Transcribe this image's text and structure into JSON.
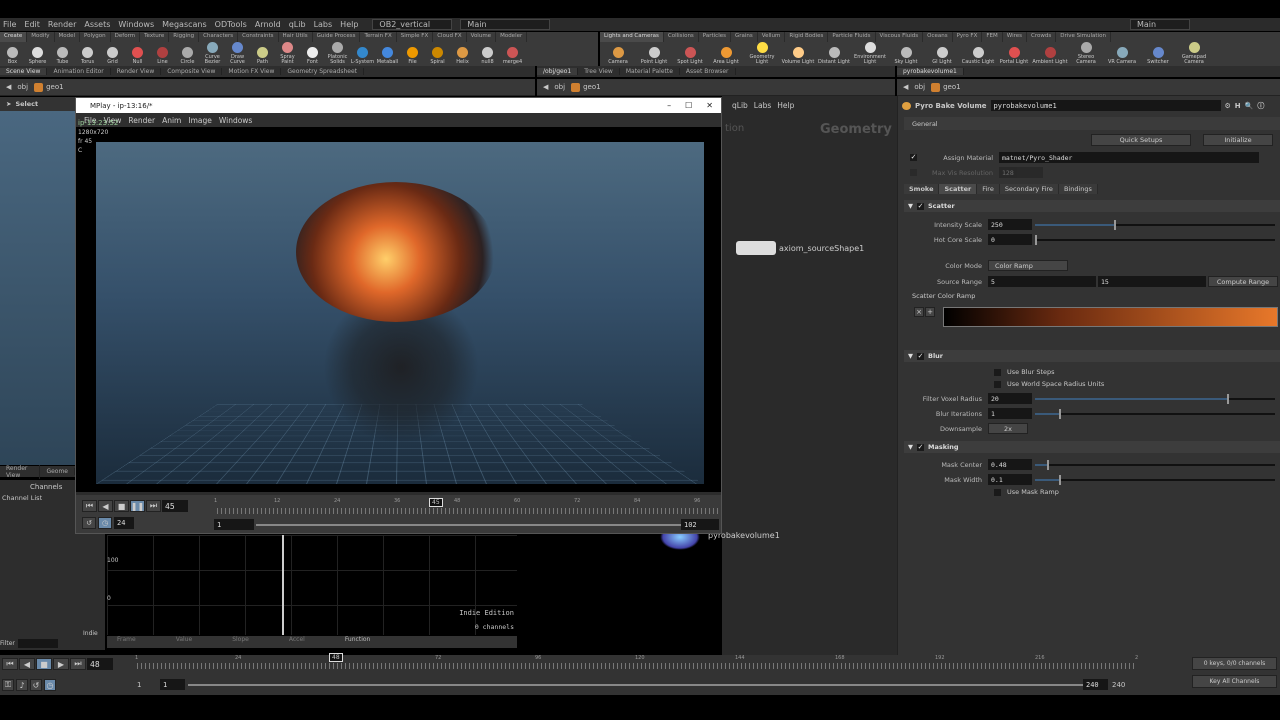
{
  "menu": [
    "File",
    "Edit",
    "Render",
    "Assets",
    "Windows",
    "Megascans",
    "ODTools",
    "Arnold",
    "qLib",
    "Labs",
    "Help"
  ],
  "desktop": "OB2_vertical",
  "context": "Main",
  "context_right": "Main",
  "shelf_tabs_left": [
    "Create",
    "Modify",
    "Model",
    "Polygon",
    "Deform",
    "Texture",
    "Rigging",
    "Characters",
    "Constraints",
    "Hair Utils",
    "Guide Process",
    "Terrain FX",
    "Simple FX",
    "Cloud FX",
    "Volume",
    "Modeler"
  ],
  "shelf_tools_left": [
    "Box",
    "Sphere",
    "Tube",
    "Torus",
    "Grid",
    "Null",
    "Line",
    "Circle",
    "Curve Bezier",
    "Draw Curve",
    "Path",
    "Spray Paint",
    "Font",
    "Platonic Solids",
    "L-System",
    "Metaball",
    "File",
    "Spiral",
    "Helix",
    "null8",
    "merge4"
  ],
  "shelf_tabs_right": [
    "Lights and Cameras",
    "Collisions",
    "Particles",
    "Grains",
    "Vellum",
    "Rigid Bodies",
    "Particle Fluids",
    "Viscous Fluids",
    "Oceans",
    "Pyro FX",
    "FEM",
    "Wires",
    "Crowds",
    "Drive Simulation"
  ],
  "shelf_tools_right": [
    "Camera",
    "Point Light",
    "Spot Light",
    "Area Light",
    "Geometry Light",
    "Volume Light",
    "Distant Light",
    "Environment Light",
    "Sky Light",
    "GI Light",
    "Caustic Light",
    "Portal Light",
    "Ambient Light",
    "Stereo Camera",
    "VR Camera",
    "Switcher",
    "Gamepad Camera"
  ],
  "pane_tabs_left": [
    "Scene View",
    "Animation Editor",
    "Render View",
    "Composite View",
    "Motion FX View",
    "Geometry Spreadsheet"
  ],
  "pane_tabs_mid": [
    "/obj/geo1",
    "Tree View",
    "Material Palette",
    "Asset Browser"
  ],
  "pane_tabs_right": [
    "pyrobakevolume1"
  ],
  "path": {
    "obj": "obj",
    "geo": "geo1"
  },
  "viewport": {
    "tool": "Select"
  },
  "mplay": {
    "title": "MPlay - ip-13:16/*",
    "menu": [
      "File",
      "View",
      "Render",
      "Anim",
      "Image",
      "Windows"
    ],
    "info": [
      "ip-13:23:52",
      "1280x720",
      "fr 45",
      "C"
    ],
    "frame": "45",
    "fps": "24",
    "range_start": "1",
    "range_end": "102",
    "ticks": [
      "1",
      "12",
      "24",
      "36",
      "48",
      "60",
      "72",
      "84",
      "96"
    ],
    "current_marker": "45"
  },
  "network": {
    "watermark": "Geometry",
    "menu_fragment": [
      "qLib",
      "Labs",
      "Help"
    ],
    "faded": "tion",
    "nodes": [
      "axiom_sourceShape1",
      "pyrobakevolume1"
    ]
  },
  "lower_tabs": [
    "Render View",
    "Geome"
  ],
  "channels": {
    "tab": "Channels",
    "list": "Channel List",
    "filter": "Filter",
    "indie": "Indie",
    "y_labels": [
      "100",
      "0"
    ],
    "edition": "Indie Edition",
    "count": "0 channels",
    "fields": [
      "Frame",
      "Value",
      "Slope",
      "Accel",
      "Function"
    ]
  },
  "params": {
    "node_type": "Pyro Bake Volume",
    "node_name": "pyrobakevolume1",
    "tab_general": "General",
    "quick_setups": "Quick Setups",
    "initialize": "Initialize",
    "assign_material_label": "Assign Material",
    "assign_material": "matnet/Pyro_Shader",
    "max_vis_label": "Max Vis Resolution",
    "max_vis": "128",
    "tabs": [
      "Smoke",
      "Scatter",
      "Fire",
      "Secondary Fire",
      "Bindings"
    ],
    "active_tab": "Scatter",
    "scatter": {
      "title": "Scatter",
      "intensity_label": "Intensity Scale",
      "intensity": "250",
      "intensity_frac": 0.33,
      "hot_core_label": "Hot Core Scale",
      "hot_core": "0",
      "color_mode_label": "Color Mode",
      "color_mode": "Color Ramp",
      "source_range_label": "Source Range",
      "range_min": "5",
      "range_max": "15",
      "compute": "Compute Range",
      "ramp_label": "Scatter Color Ramp",
      "ramp_start": "#000000",
      "ramp_end": "#e8782a"
    },
    "blur": {
      "title": "Blur",
      "use_steps": "Use Blur Steps",
      "use_world": "Use World Space Radius Units",
      "filter_label": "Filter Voxel Radius",
      "filter": "20",
      "filter_frac": 0.8,
      "iter_label": "Blur Iterations",
      "iter": "1",
      "iter_frac": 0.1,
      "down_label": "Downsample",
      "down": "2x"
    },
    "masking": {
      "title": "Masking",
      "center_label": "Mask Center",
      "center": "0.48",
      "center_frac": 0.05,
      "width_label": "Mask Width",
      "width": "0.1",
      "width_frac": 0.1,
      "use_ramp": "Use Mask Ramp"
    }
  },
  "playbar": {
    "frame": "48",
    "ticks": [
      "1",
      "24",
      "48",
      "72",
      "96",
      "120",
      "144",
      "168",
      "192",
      "216",
      "2"
    ],
    "marker": "48",
    "start": "1",
    "start2": "1",
    "end": "240",
    "end2": "240",
    "keys": "0 keys, 0/0 channels",
    "key_all": "Key All Channels"
  }
}
